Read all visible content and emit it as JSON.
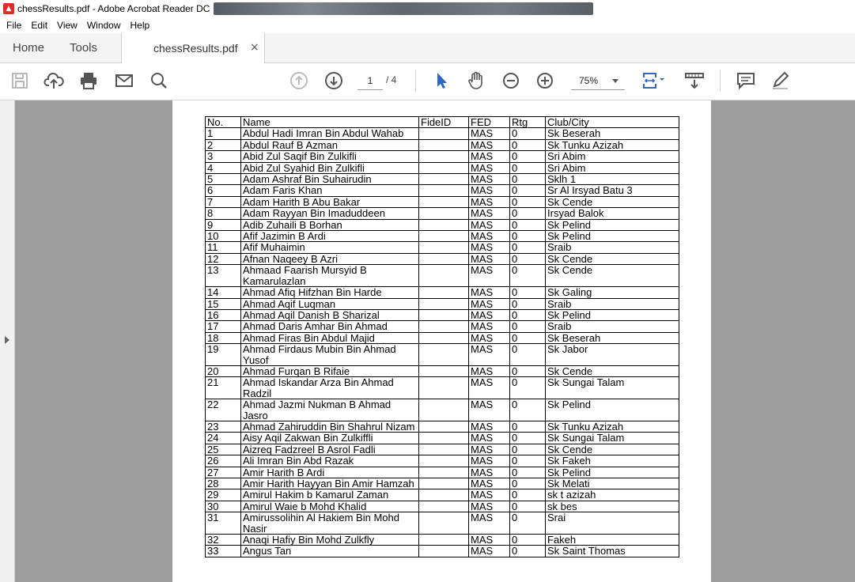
{
  "window": {
    "title": "chessResults.pdf - Adobe Acrobat Reader DC",
    "app_icon": "acrobat-icon"
  },
  "menu": [
    "File",
    "Edit",
    "View",
    "Window",
    "Help"
  ],
  "tabs": {
    "home": "Home",
    "tools": "Tools",
    "document": "chessResults.pdf",
    "close_glyph": "×"
  },
  "toolbar": {
    "page_current": "1",
    "page_total": "/ 4",
    "zoom": "75%",
    "icons": [
      "save-icon",
      "upload-icon",
      "print-icon",
      "email-icon",
      "search-icon",
      "prev-page-icon",
      "next-page-icon",
      "select-cursor-icon",
      "hand-icon",
      "zoom-out-icon",
      "zoom-in-icon",
      "fit-page-icon",
      "scroll-mode-icon",
      "comment-icon",
      "sign-icon"
    ],
    "accent": "#2d6ac7"
  },
  "table": {
    "headers": [
      "No.",
      "Name",
      "FideID",
      "FED",
      "Rtg",
      "Club/City"
    ],
    "rows": [
      [
        "1",
        "Abdul Hadi Imran Bin Abdul Wahab",
        "",
        "MAS",
        "0",
        "Sk Beserah"
      ],
      [
        "2",
        "Abdul Rauf B Azman",
        "",
        "MAS",
        "0",
        "Sk Tunku Azizah"
      ],
      [
        "3",
        "Abid Zul Saqif Bin Zulkifli",
        "",
        "MAS",
        "0",
        "Sri Abim"
      ],
      [
        "4",
        "Abid Zul Syahid Bin Zulkifli",
        "",
        "MAS",
        "0",
        "Sri Abim"
      ],
      [
        "5",
        "Adam Ashraf Bin Suhairudin",
        "",
        "MAS",
        "0",
        "Sklh 1"
      ],
      [
        "6",
        "Adam Faris Khan",
        "",
        "MAS",
        "0",
        "Sr Al Irsyad Batu 3"
      ],
      [
        "7",
        "Adam Harith B Abu Bakar",
        "",
        "MAS",
        "0",
        "Sk Cende"
      ],
      [
        "8",
        "Adam Rayyan Bin Imaduddeen",
        "",
        "MAS",
        "0",
        "Irsyad Balok"
      ],
      [
        "9",
        "Adib Zuhaili B Borhan",
        "",
        "MAS",
        "0",
        "Sk Pelind"
      ],
      [
        "10",
        "Afif Jazimin B Ardi",
        "",
        "MAS",
        "0",
        "Sk Pelind"
      ],
      [
        "11",
        "Afif Muhaimin",
        "",
        "MAS",
        "0",
        "Sraib"
      ],
      [
        "12",
        "Afnan Naqeey B Azri",
        "",
        "MAS",
        "0",
        "Sk Cende"
      ],
      [
        "13",
        "Ahmaad Faarish Mursyid B Kamarulazlan",
        "",
        "MAS",
        "0",
        "Sk Cende"
      ],
      [
        "14",
        "Ahmad Afiq Hifzhan Bin Harde",
        "",
        "MAS",
        "0",
        "Sk Galing"
      ],
      [
        "15",
        "Ahmad Aqif Luqman",
        "",
        "MAS",
        "0",
        "Sraib"
      ],
      [
        "16",
        "Ahmad Aqil Danish B Sharizal",
        "",
        "MAS",
        "0",
        "Sk Pelind"
      ],
      [
        "17",
        "Ahmad Daris Amhar Bin Ahmad",
        "",
        "MAS",
        "0",
        "Sraib"
      ],
      [
        "18",
        "Ahmad Firas Bin Abdul Majid",
        "",
        "MAS",
        "0",
        "Sk Beserah"
      ],
      [
        "19",
        "Ahmad Firdaus Mubin Bin Ahmad Yusof",
        "",
        "MAS",
        "0",
        "Sk Jabor"
      ],
      [
        "20",
        "Ahmad Furqan B Rifaie",
        "",
        "MAS",
        "0",
        "Sk Cende"
      ],
      [
        "21",
        "Ahmad Iskandar Arza Bin Ahmad Radzil",
        "",
        "MAS",
        "0",
        "Sk Sungai Talam"
      ],
      [
        "22",
        "Ahmad Jazmi Nukman B Ahmad Jasro",
        "",
        "MAS",
        "0",
        "Sk Pelind"
      ],
      [
        "23",
        "Ahmad Zahiruddin Bin Shahrul Nizam",
        "",
        "MAS",
        "0",
        "Sk Tunku Azizah"
      ],
      [
        "24",
        "Aisy Aqil Zakwan Bin Zulkiffli",
        "",
        "MAS",
        "0",
        "Sk Sungai Talam"
      ],
      [
        "25",
        "Aizreq Fadzreel B Asrol Fadli",
        "",
        "MAS",
        "0",
        "Sk Cende"
      ],
      [
        "26",
        "Ali Imran Bin Abd Razak",
        "",
        "MAS",
        "0",
        "Sk Fakeh"
      ],
      [
        "27",
        "Amir Harith B Ardi",
        "",
        "MAS",
        "0",
        "Sk Pelind"
      ],
      [
        "28",
        "Amir Harith Hayyan Bin Amir Hamzah",
        "",
        "MAS",
        "0",
        "Sk Melati"
      ],
      [
        "29",
        "Amirul Hakim b Kamarul Zaman",
        "",
        "MAS",
        "0",
        "sk t azizah"
      ],
      [
        "30",
        "Amirul Waie b Mohd Khalid",
        "",
        "MAS",
        "0",
        "sk bes"
      ],
      [
        "31",
        "Amirussolihin Al Hakiem Bin Mohd Nasir",
        "",
        "MAS",
        "0",
        "Srai"
      ],
      [
        "32",
        "Anaqi Hafiy Bin Mohd Zulkfly",
        "",
        "MAS",
        "0",
        "Fakeh"
      ],
      [
        "33",
        "Angus Tan",
        "",
        "MAS",
        "0",
        "Sk Saint Thomas"
      ]
    ]
  }
}
